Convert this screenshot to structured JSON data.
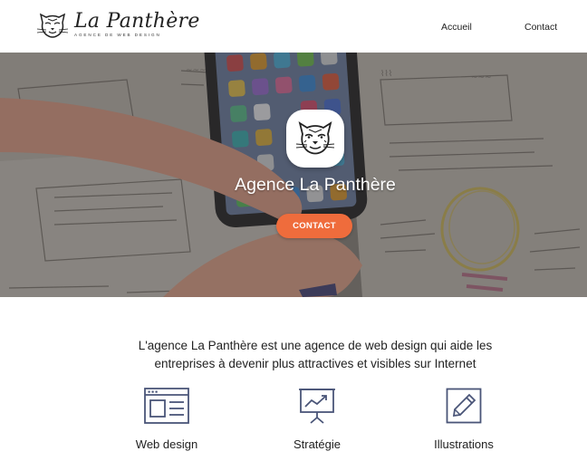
{
  "brand": {
    "title": "La Panthère",
    "subtitle": "AGENCE DE WEB DESIGN"
  },
  "nav": {
    "items": [
      {
        "label": "Accueil"
      },
      {
        "label": "Contact"
      }
    ]
  },
  "hero": {
    "title": "Agence La Panthère",
    "cta_label": "CONTACT",
    "cta_color": "#ef6c3c"
  },
  "intro": {
    "line1": "L'agence La Panthère est une agence de web design qui aide les",
    "line2": "entreprises à devenir plus attractives et visibles sur Internet"
  },
  "services": [
    {
      "label": "Web design",
      "icon": "browser-window-icon"
    },
    {
      "label": "Stratégie",
      "icon": "presentation-chart-icon"
    },
    {
      "label": "Illustrations",
      "icon": "pencil-icon"
    }
  ],
  "colors": {
    "accent": "#ef6c3c",
    "icon_color": "#4a5578",
    "text": "#222222"
  }
}
